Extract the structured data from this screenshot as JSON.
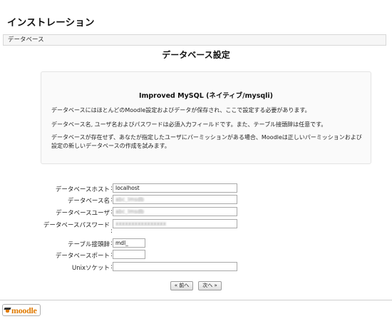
{
  "header": {
    "title": "インストレーション"
  },
  "breadcrumb": {
    "label": "データベース"
  },
  "section": {
    "heading": "データベース設定"
  },
  "info": {
    "title": "Improved MySQL (ネイティブ/mysqli)",
    "paragraphs": [
      "データベースにはほとんどのMoodle設定およびデータが保存され、ここで設定する必要があります。",
      "データベース名, ユーザ名およびパスワードは必須入力フィールドです。また、テーブル接頭辞は任意です。",
      "データベースが存在せず、あなたが指定したユーザにパーミッションがある場合、Moodleは正しいパーミッションおよび設定の新しいデータベースの作成を試みます。"
    ]
  },
  "form": {
    "fields": [
      {
        "label": "データベースホスト",
        "value": "localhost"
      },
      {
        "label": "データベース名",
        "value": "abc_lmsdb"
      },
      {
        "label": "データベースユーザ",
        "value": "abc_lmsdb"
      },
      {
        "label": "データベースパスワード",
        "value": "xxxxxxxxxxxxxxxx"
      },
      {
        "label": "テーブル接頭辞",
        "value": "mdl_"
      },
      {
        "label": "データベースポート",
        "value": ""
      },
      {
        "label": "Unixソケット",
        "value": ""
      }
    ]
  },
  "buttons": {
    "prev": "« 前へ",
    "next": "次へ »"
  },
  "footer": {
    "logo_text": "moodle"
  }
}
